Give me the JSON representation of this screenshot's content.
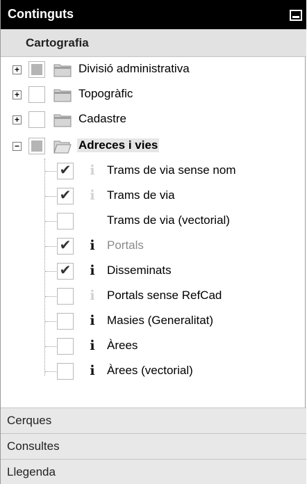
{
  "panel": {
    "title": "Continguts"
  },
  "sections": {
    "active": "Cartografia",
    "bottom": [
      "Cerques",
      "Consultes",
      "Llegenda"
    ]
  },
  "groups": [
    {
      "label": "Divisió administrativa",
      "expander": "+",
      "check": "partial"
    },
    {
      "label": "Topogràfic",
      "expander": "+",
      "check": "empty"
    },
    {
      "label": "Cadastre",
      "expander": "+",
      "check": "empty"
    },
    {
      "label": "Adreces i vies",
      "expander": "−",
      "check": "partial",
      "expanded": true
    }
  ],
  "layers": [
    {
      "label": "Trams de via sense nom",
      "checked": true,
      "info": "dim"
    },
    {
      "label": "Trams de via",
      "checked": true,
      "info": "dim"
    },
    {
      "label": "Trams de via (vectorial)",
      "checked": false,
      "info": "none"
    },
    {
      "label": "Portals",
      "checked": true,
      "info": "dark",
      "greyed": true
    },
    {
      "label": "Disseminats",
      "checked": true,
      "info": "dark"
    },
    {
      "label": "Portals sense RefCad",
      "checked": false,
      "info": "dim"
    },
    {
      "label": "Masies (Generalitat)",
      "checked": false,
      "info": "dark"
    },
    {
      "label": "Àrees",
      "checked": false,
      "info": "dark"
    },
    {
      "label": "Àrees (vectorial)",
      "checked": false,
      "info": "dark"
    }
  ],
  "glyphs": {
    "check": "✔",
    "info": "i"
  }
}
